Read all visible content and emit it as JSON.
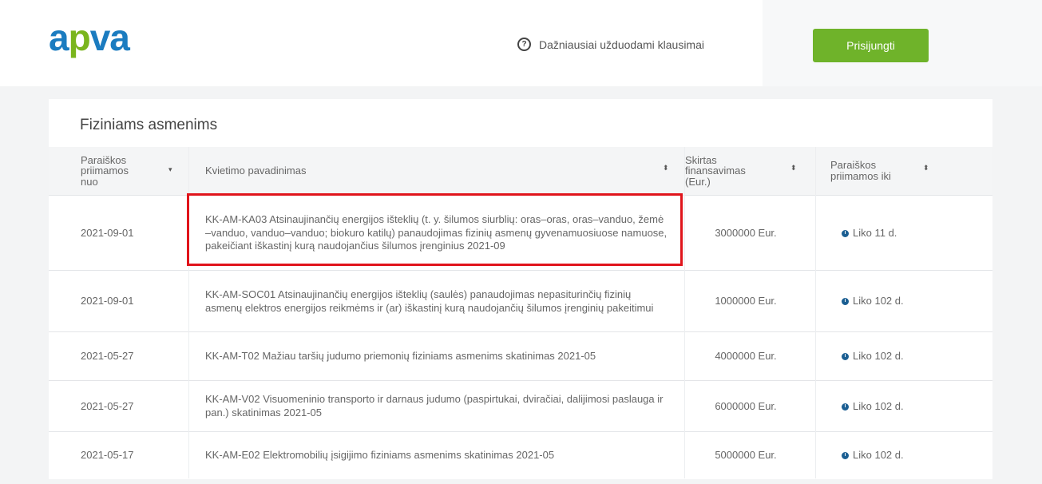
{
  "header": {
    "logo_prefix": "a",
    "logo_p": "p",
    "logo_suffix": "va",
    "faq_icon": "question-circle-icon",
    "faq_label": "Dažniausiai užduodami klausimai",
    "login_label": "Prisijungti"
  },
  "colors": {
    "brand_blue": "#1b7cc0",
    "brand_green": "#7ab51d",
    "button_green": "#6fb32a",
    "highlight_red": "#e0141b",
    "clock_icon": "#1a5e92"
  },
  "section": {
    "title": "Fiziniams asmenims"
  },
  "table": {
    "columns": [
      {
        "label": "Paraiškos priimamos nuo",
        "sort_icon": "sort-down-icon"
      },
      {
        "label": "Kvietimo pavadinimas",
        "sort_icon": "sort-icon"
      },
      {
        "label": "Skirtas finansavimas (Eur.)",
        "sort_icon": "sort-icon"
      },
      {
        "label": "Paraiškos priimamos iki",
        "sort_icon": "sort-icon"
      }
    ],
    "rows": [
      {
        "date": "2021-09-01",
        "name": "KK-AM-KA03 Atsinaujinančių energijos išteklių (t. y. šilumos siurblių: oras–oras, oras–vanduo, žemė –vanduo, vanduo–vanduo; biokuro katilų) panaudojimas fizinių asmenų gyvenamuosiuose namuose, pakeičiant iškastinį kurą naudojančius šilumos įrenginius 2021-09",
        "amount": "3000000 Eur.",
        "days": "Liko 11 d.",
        "highlighted": true
      },
      {
        "date": "2021-09-01",
        "name": "KK-AM-SOC01 Atsinaujinančių energijos išteklių (saulės) panaudojimas nepasiturinčių fizinių asmenų elektros energijos reikmėms ir (ar) iškastinį kurą naudojančių šilumos įrenginių pakeitimui",
        "amount": "1000000 Eur.",
        "days": "Liko 102 d.",
        "highlighted": false
      },
      {
        "date": "2021-05-27",
        "name": "KK-AM-T02 Mažiau taršių judumo priemonių fiziniams asmenims skatinimas 2021-05",
        "amount": "4000000 Eur.",
        "days": "Liko 102 d.",
        "highlighted": false
      },
      {
        "date": "2021-05-27",
        "name": "KK-AM-V02 Visuomeninio transporto ir darnaus judumo (paspirtukai, dviračiai, dalijimosi paslauga ir pan.) skatinimas 2021-05",
        "amount": "6000000 Eur.",
        "days": "Liko 102 d.",
        "highlighted": false
      },
      {
        "date": "2021-05-17",
        "name": "KK-AM-E02 Elektromobilių įsigijimo fiziniams asmenims skatinimas 2021-05",
        "amount": "5000000 Eur.",
        "days": "Liko 102 d.",
        "highlighted": false
      }
    ]
  }
}
